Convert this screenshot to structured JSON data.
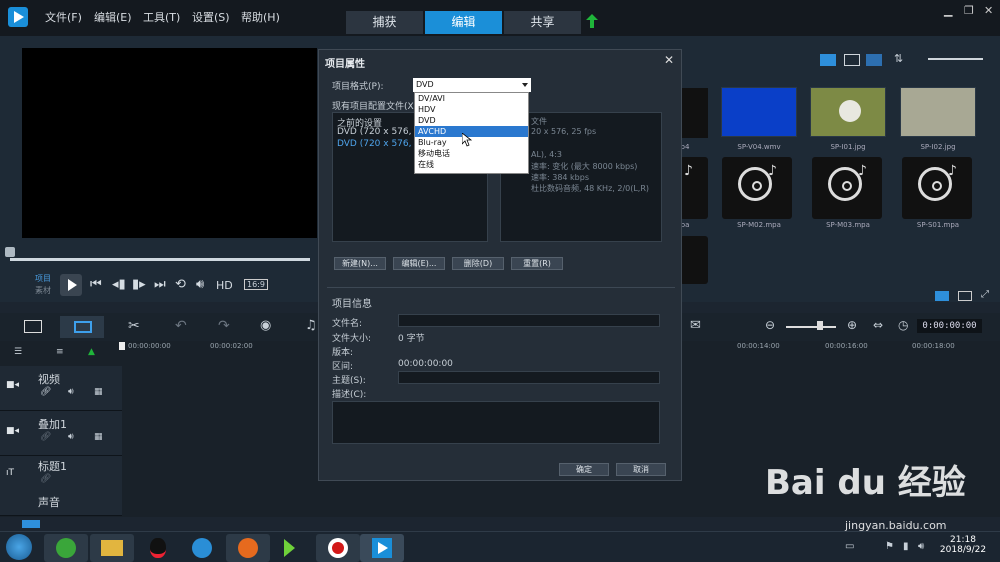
{
  "menu": {
    "file": "文件(F)",
    "edit": "编辑(E)",
    "tools": "工具(T)",
    "settings": "设置(S)",
    "help": "帮助(H)"
  },
  "tabs": {
    "capture": "捕获",
    "edit": "编辑",
    "share": "共享"
  },
  "preview": {
    "project": "项目",
    "clip": "素材",
    "hd": "HD",
    "aspect": "16:9"
  },
  "library": {
    "row1": [
      {
        "label": "p4"
      },
      {
        "label": "SP-V04.wmv"
      },
      {
        "label": "SP-I01.jpg"
      },
      {
        "label": "SP-I02.jpg"
      }
    ],
    "row2": [
      {
        "label": "pa"
      },
      {
        "label": "SP-M02.mpa"
      },
      {
        "label": "SP-M03.mpa"
      },
      {
        "label": "SP-S01.mpa"
      }
    ]
  },
  "timeline": {
    "timecode": "0:00:00:00",
    "ruler": [
      "00:00:00:00",
      "00:00:02:00",
      "00:00:14:00",
      "00:00:16:00",
      "00:00:18:00"
    ],
    "tracks": [
      {
        "name": "视频"
      },
      {
        "name": "叠加1"
      },
      {
        "name": "标题1"
      },
      {
        "name": "声音"
      }
    ]
  },
  "dialog": {
    "title": "项目属性",
    "format_label": "项目格式(P):",
    "format_value": "DVD",
    "profiles_label": "现有项目配置文件(X):",
    "profiles": [
      "之前的设置",
      "DVD (720 x 576, 16:9",
      "DVD (720 x 576, 4:3"
    ],
    "info_lines": [
      "文件",
      "20 x 576, 25 fps",
      "AL), 4:3",
      "速率: 变化 (最大 8000 kbps)",
      "速率: 384 kbps",
      "杜比数码音频, 48 KHz, 2/0(L,R)"
    ],
    "buttons": {
      "new": "新建(N)...",
      "edit": "编辑(E)...",
      "delete": "删除(D)",
      "reset": "重置(R)"
    },
    "project_info_label": "项目信息",
    "fields": {
      "filename": "文件名:",
      "filesize": "文件大小:",
      "filesize_value": "0 字节",
      "version": "版本:",
      "duration": "区间:",
      "duration_value": "00:00:00:00",
      "subject": "主题(S):",
      "description": "描述(C):"
    },
    "ok": "确定",
    "cancel": "取消",
    "options": [
      "DV/AVI",
      "HDV",
      "DVD",
      "AVCHD",
      "Blu-ray",
      "移动电话",
      "在线"
    ]
  },
  "taskbar": {
    "time": "21:18",
    "date": "2018/9/22"
  },
  "watermark": {
    "brand": "Bai du 经验",
    "url": "jingyan.baidu.com"
  },
  "colors": {
    "accent": "#1b8fd8",
    "selection": "#2a78cf"
  }
}
